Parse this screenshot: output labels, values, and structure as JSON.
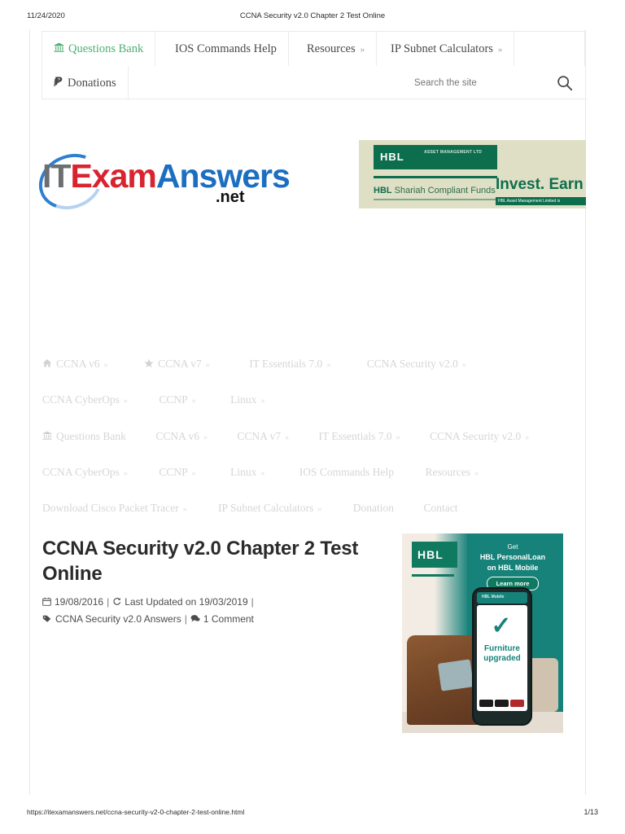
{
  "print": {
    "date": "11/24/2020",
    "title": "CCNA Security v2.0 Chapter 2 Test Online",
    "url": "https://itexamanswers.net/ccna-security-v2-0-chapter-2-test-online.html",
    "page": "1/13"
  },
  "topnav": {
    "items": [
      {
        "label": "Questions Bank",
        "icon": "bank-icon",
        "icon_glyph": "🏛",
        "caret": "",
        "accent": "#4CAF72"
      },
      {
        "label": "IOS Commands Help",
        "icon": "",
        "icon_glyph": "",
        "caret": ""
      },
      {
        "label": "Resources",
        "icon": "",
        "icon_glyph": "",
        "caret": "»"
      },
      {
        "label": "IP Subnet Calculators",
        "icon": "",
        "icon_glyph": "",
        "caret": "»"
      },
      {
        "label": "Donations",
        "icon": "paypal-icon",
        "icon_glyph": "Ṗ",
        "caret": ""
      }
    ]
  },
  "search": {
    "placeholder": "Search the site",
    "value": ""
  },
  "logo": {
    "it": "IT",
    "exam": "Exam",
    "answers": "Answers",
    "net": ".net"
  },
  "banner_ad": {
    "hbl": "HBL",
    "asset_management": "ASSET MANAGEMENT LTD",
    "shariah_brand": "HBL",
    "shariah_text": "Shariah Compliant Funds",
    "headline": "Invest. Earn",
    "disclaimer": "HBL Asset Management Limited is"
  },
  "menus": {
    "block1": [
      [
        {
          "label": "CCNA v6",
          "icon": "home-icon",
          "icon_glyph": "⌂",
          "caret": "»"
        },
        {
          "label": "CCNA v7",
          "icon": "star-icon",
          "icon_glyph": "★",
          "caret": "»"
        },
        {
          "label": "IT Essentials 7.0",
          "icon": "",
          "icon_glyph": "",
          "caret": "»"
        },
        {
          "label": "CCNA Security v2.0",
          "icon": "",
          "icon_glyph": "",
          "caret": "»"
        }
      ],
      [
        {
          "label": "CCNA CyberOps",
          "icon": "",
          "icon_glyph": "",
          "caret": "»"
        },
        {
          "label": "CCNP",
          "icon": "",
          "icon_glyph": "",
          "caret": "»"
        },
        {
          "label": "Linux",
          "icon": "",
          "icon_glyph": "",
          "caret": "»"
        }
      ]
    ],
    "block2": [
      [
        {
          "label": "Questions Bank",
          "icon": "bank-icon",
          "icon_glyph": "🏛",
          "caret": ""
        },
        {
          "label": "CCNA v6",
          "icon": "",
          "icon_glyph": "",
          "caret": "»"
        },
        {
          "label": "CCNA v7",
          "icon": "",
          "icon_glyph": "",
          "caret": "»"
        },
        {
          "label": "IT Essentials 7.0",
          "icon": "",
          "icon_glyph": "",
          "caret": "»"
        },
        {
          "label": "CCNA Security v2.0",
          "icon": "",
          "icon_glyph": "",
          "caret": "»"
        }
      ],
      [
        {
          "label": "CCNA CyberOps",
          "icon": "",
          "icon_glyph": "",
          "caret": "»"
        },
        {
          "label": "CCNP",
          "icon": "",
          "icon_glyph": "",
          "caret": "»"
        },
        {
          "label": "Linux",
          "icon": "",
          "icon_glyph": "",
          "caret": "»"
        },
        {
          "label": "IOS Commands Help",
          "icon": "",
          "icon_glyph": "",
          "caret": ""
        },
        {
          "label": "Resources",
          "icon": "",
          "icon_glyph": "",
          "caret": "»"
        }
      ]
    ],
    "block3": [
      [
        {
          "label": "Download Cisco Packet Tracer",
          "icon": "",
          "icon_glyph": "",
          "caret": "»"
        },
        {
          "label": "IP Subnet Calculators",
          "icon": "",
          "icon_glyph": "",
          "caret": "»"
        },
        {
          "label": "Donation",
          "icon": "",
          "icon_glyph": "",
          "caret": ""
        },
        {
          "label": "Contact",
          "icon": "",
          "icon_glyph": "",
          "caret": ""
        }
      ]
    ]
  },
  "article": {
    "title": "CCNA Security v2.0 Chapter 2 Test Online",
    "published": "19/08/2016",
    "updated": "Last Updated on 19/03/2019",
    "category": "CCNA Security v2.0 Answers",
    "comments": "1 Comment"
  },
  "side_ad": {
    "hbl": "HBL",
    "line1": "Get",
    "line2": "HBL PersonalLoan",
    "line3": "on HBL Mobile",
    "cta": "Learn more",
    "phone_brand": "HBL Mobile",
    "phone_text_1": "Furniture",
    "phone_text_2": "upgraded"
  }
}
